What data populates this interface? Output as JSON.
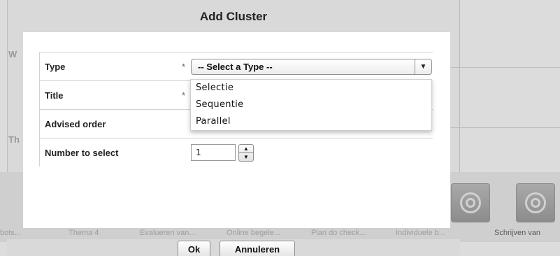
{
  "dialog": {
    "title": "Add Cluster",
    "ok_label": "Ok",
    "cancel_label": "Annuleren"
  },
  "form": {
    "type": {
      "label": "Type",
      "required_mark": "*",
      "selected": "-- Select a Type --",
      "options": [
        "Selectie",
        "Sequentie",
        "Parallel"
      ]
    },
    "title": {
      "label": "Title",
      "required_mark": "*"
    },
    "advised_order": {
      "label": "Advised order"
    },
    "number_to_select": {
      "label": "Number to select",
      "value": "1"
    }
  },
  "background": {
    "letters": [
      "W",
      "Th"
    ],
    "tiles": [
      {
        "label": "bots..."
      },
      {
        "label": "Thema 4"
      },
      {
        "label": "Evalueren van..."
      },
      {
        "label": "Online begele..."
      },
      {
        "label": "Plan do check..."
      },
      {
        "label": "Individuele b..."
      },
      {
        "label": "Schrijven van"
      }
    ]
  },
  "colors": {
    "overlay": "#d7d7d7",
    "dialog_bg": "#ffffff",
    "border": "#d2d2d2"
  },
  "icons": {
    "dropdown_arrow": "chevron-down-icon",
    "stepper_up": "triangle-up-icon",
    "stepper_down": "triangle-down-icon",
    "tile_icon": "target-icon"
  }
}
